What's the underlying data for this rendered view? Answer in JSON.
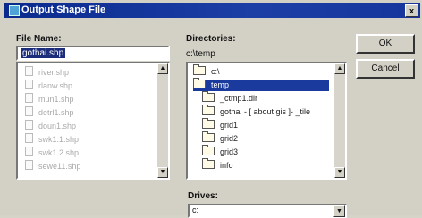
{
  "window": {
    "title": "Output Shape File",
    "close_label": "x"
  },
  "file_name": {
    "label": "File Name:",
    "value": "gothai.shp"
  },
  "files": [
    "river.shp",
    "rlanw.shp",
    "mun1.shp",
    "detrl1.shp",
    "doun1.shp",
    "swk1.1.shp",
    "swk1.2.shp",
    "sewe11.shp"
  ],
  "directories": {
    "label": "Directories:",
    "current_path": "c:\\temp",
    "items": [
      {
        "label": "c:\\",
        "selected": false,
        "indent": 0
      },
      {
        "label": "temp",
        "selected": true,
        "indent": 0
      },
      {
        "label": "_ctmp1.dir",
        "selected": false,
        "indent": 1
      },
      {
        "label": "gothai - [ about gis ]- _tile",
        "selected": false,
        "indent": 1
      },
      {
        "label": "grid1",
        "selected": false,
        "indent": 1
      },
      {
        "label": "grid2",
        "selected": false,
        "indent": 1
      },
      {
        "label": "grid3",
        "selected": false,
        "indent": 1
      },
      {
        "label": "info",
        "selected": false,
        "indent": 1
      }
    ]
  },
  "buttons": {
    "ok": "OK",
    "cancel": "Cancel"
  },
  "drives": {
    "label": "Drives:",
    "value": "c:"
  },
  "icons": [
    "window-app-icon",
    "close-icon",
    "file-icon",
    "folder-icon",
    "scroll-up-icon",
    "scroll-down-icon",
    "dropdown-arrow-icon"
  ]
}
